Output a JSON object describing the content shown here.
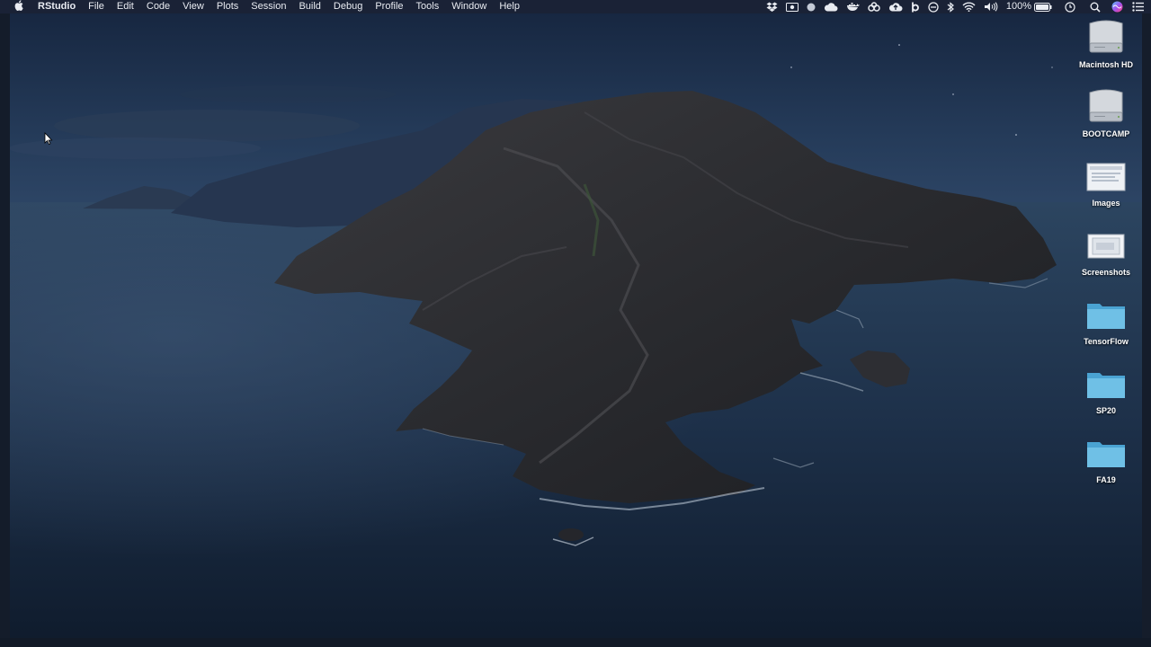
{
  "menubar": {
    "apple_icon": "apple-icon",
    "app_name": "RStudio",
    "items": [
      "File",
      "Edit",
      "Code",
      "View",
      "Plots",
      "Session",
      "Build",
      "Debug",
      "Profile",
      "Tools",
      "Window",
      "Help"
    ],
    "status_icons": [
      "dropbox-icon",
      "screen-record-icon",
      "dot-icon",
      "cloud-icon",
      "docker-icon",
      "creative-cloud-icon",
      "cloud-upload-icon",
      "b-icon",
      "circle-minus-icon",
      "bluetooth-icon",
      "wifi-icon",
      "volume-icon"
    ],
    "battery_text": "100%",
    "clock_icon": "clock-icon",
    "search_icon": "spotlight-search-icon",
    "siri_icon": "siri-icon",
    "control_icon": "notification-center-icon"
  },
  "desktop": {
    "icons": [
      {
        "label": "Macintosh HD",
        "kind": "hard-drive-icon"
      },
      {
        "label": "BOOTCAMP",
        "kind": "hard-drive-icon"
      },
      {
        "label": "Images",
        "kind": "screenshot-folder-icon"
      },
      {
        "label": "Screenshots",
        "kind": "screenshot-folder-icon"
      },
      {
        "label": "TensorFlow",
        "kind": "folder-icon"
      },
      {
        "label": "SP20",
        "kind": "folder-icon"
      },
      {
        "label": "FA19",
        "kind": "folder-icon"
      }
    ]
  },
  "colors": {
    "menubar_bg": "#1a2236",
    "folder_blue": "#5fb4dc",
    "sea": "#1c3148",
    "sky": "#1f3350"
  }
}
